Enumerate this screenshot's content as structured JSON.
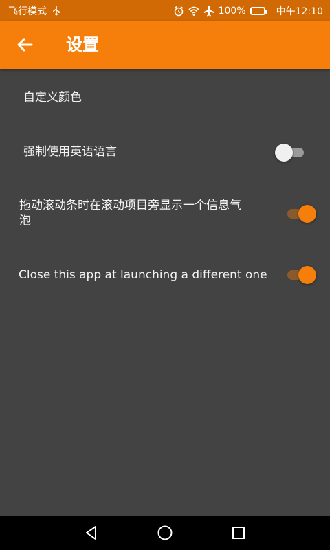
{
  "status_bar": {
    "left_text": "飞行模式",
    "usb_icon": "usb-icon",
    "alarm_icon": "alarm-icon",
    "wifi_icon": "wifi-icon",
    "airplane_icon": "airplane-icon",
    "battery_percent": "100%",
    "battery_icon": "battery-charging-icon",
    "time": "中午12:10"
  },
  "app_bar": {
    "back_icon": "arrow-left-icon",
    "title": "设置",
    "background": "#f57f0a"
  },
  "settings": [
    {
      "label": "自定义颜色"
    },
    {
      "label": "强制使用英语语言",
      "toggle": false
    },
    {
      "label_line1": "拖动滚动条时在滚动项目旁显示一个信息气",
      "label_line2": "泡",
      "toggle": true
    },
    {
      "label": "Close this app at launching a different one",
      "toggle": true
    }
  ],
  "nav_bar": {
    "back_icon": "triangle-back-icon",
    "home_icon": "circle-home-icon",
    "recents_icon": "square-recents-icon"
  },
  "colors": {
    "accent": "#f57f0a",
    "status_bar": "#d16904",
    "background": "#434343",
    "nav_bar": "#000000"
  }
}
